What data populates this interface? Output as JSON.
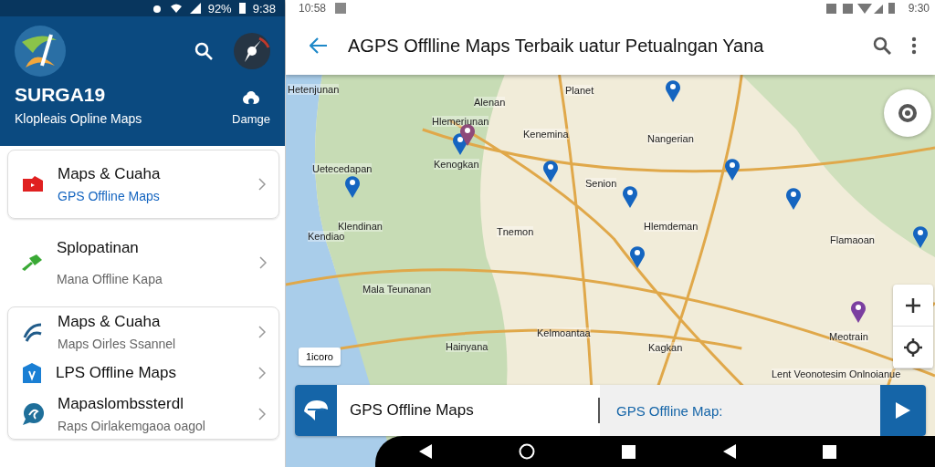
{
  "left_status": {
    "battery": "92%",
    "time": "9:38"
  },
  "drawer_header": {
    "title": "SURGA19",
    "subtitle": "Klopleais Opline Maps",
    "action_label": "Damge"
  },
  "menu_groups": [
    {
      "card": true,
      "items": [
        {
          "kind": "video",
          "title": "Maps & Cuaha",
          "subtitle": "GPS Offline Maps",
          "subtitle_link": true
        }
      ]
    },
    {
      "card": false,
      "items": [
        {
          "kind": "pin",
          "title": "Splopatinan",
          "subtitle": "Mana Offline Kapa",
          "subtitle_link": false
        }
      ]
    },
    {
      "card": true,
      "items": [
        {
          "kind": "route",
          "title": "Maps & Cuaha",
          "subtitle": "Maps Oirles Ssannel",
          "subtitle_link": false
        },
        {
          "kind": "home",
          "title": "LPS Offline Maps"
        },
        {
          "kind": "chat",
          "title": "Mapaslombssterdl",
          "subtitle": "Raps Oirlakemgaoa oagol",
          "subtitle_link": false
        }
      ]
    }
  ],
  "right_status": {
    "clock": "10:58",
    "time": "9:30"
  },
  "app_bar": {
    "title": "AGPS Offlline Maps Terbaik uatur Petualngan Yana"
  },
  "map": {
    "places": [
      "Hetenjunan",
      "Alenan",
      "Planet",
      "Hlemerjunan",
      "Kenemina",
      "Nangerian",
      "Kenogkan",
      "Uetecedapan",
      "Senion",
      "Klendinan",
      "Kendiao",
      "Tnemon",
      "Hlemdeman",
      "Flamaoan",
      "Mala Teunanan",
      "Kelmoantaa",
      "Kagkan",
      "Hainyana",
      "Meotrain",
      "Lent Veonotesim Onlnoianue"
    ],
    "pins": [
      {
        "color": "#1565c0"
      },
      {
        "color": "#8e4a7a"
      },
      {
        "color": "#1565c0"
      },
      {
        "color": "#1565c0"
      },
      {
        "color": "#1565c0"
      },
      {
        "color": "#1565c0"
      },
      {
        "color": "#1565c0"
      },
      {
        "color": "#1565c0"
      },
      {
        "color": "#1565c0"
      },
      {
        "color": "#1565c0"
      },
      {
        "color": "#7b3fa0"
      }
    ],
    "scale_label": "1icoro"
  },
  "search_bar": {
    "value": "GPS Offline Maps",
    "suggestion": "GPS Offline Map:"
  }
}
